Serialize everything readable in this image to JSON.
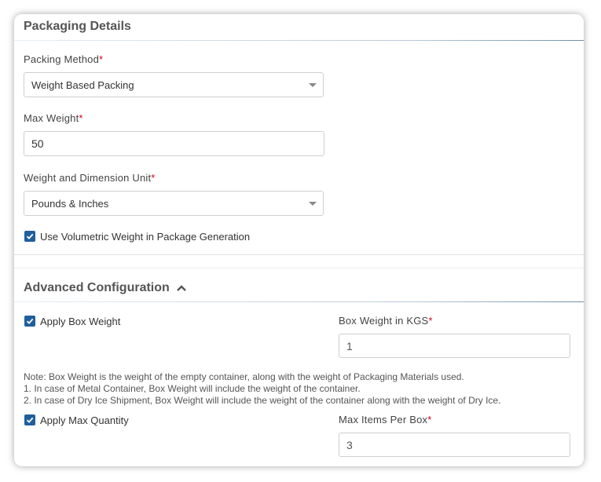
{
  "packaging": {
    "title": "Packaging Details",
    "packing_method": {
      "label": "Packing Method",
      "required": "*",
      "value": "Weight Based Packing"
    },
    "max_weight": {
      "label": "Max Weight",
      "required": "*",
      "value": "50"
    },
    "unit": {
      "label": "Weight and Dimension Unit",
      "required": "*",
      "value": "Pounds & Inches"
    },
    "volumetric": {
      "label": "Use Volumetric Weight in Package Generation",
      "checked": true
    }
  },
  "advanced": {
    "title": "Advanced Configuration",
    "toggle_icon": "chevron-up-icon",
    "apply_box_weight": {
      "label": "Apply Box Weight",
      "checked": true
    },
    "box_weight": {
      "label": "Box Weight in KGS",
      "required": "*",
      "value": "1"
    },
    "note": {
      "line1": "Note: Box Weight is the weight of the empty container, along with the weight of Packaging Materials used.",
      "line2": "1. In case of Metal Container, Box Weight will include the weight of the container.",
      "line3": "2. In case of Dry Ice Shipment, Box Weight will include the weight of the container along with the weight of Dry Ice."
    },
    "apply_max_quantity": {
      "label": "Apply Max Quantity",
      "checked": true
    },
    "max_items": {
      "label": "Max Items Per Box",
      "required": "*",
      "value": "3"
    }
  },
  "colors": {
    "checkbox": "#1f5f9e",
    "required": "#d0021b"
  }
}
